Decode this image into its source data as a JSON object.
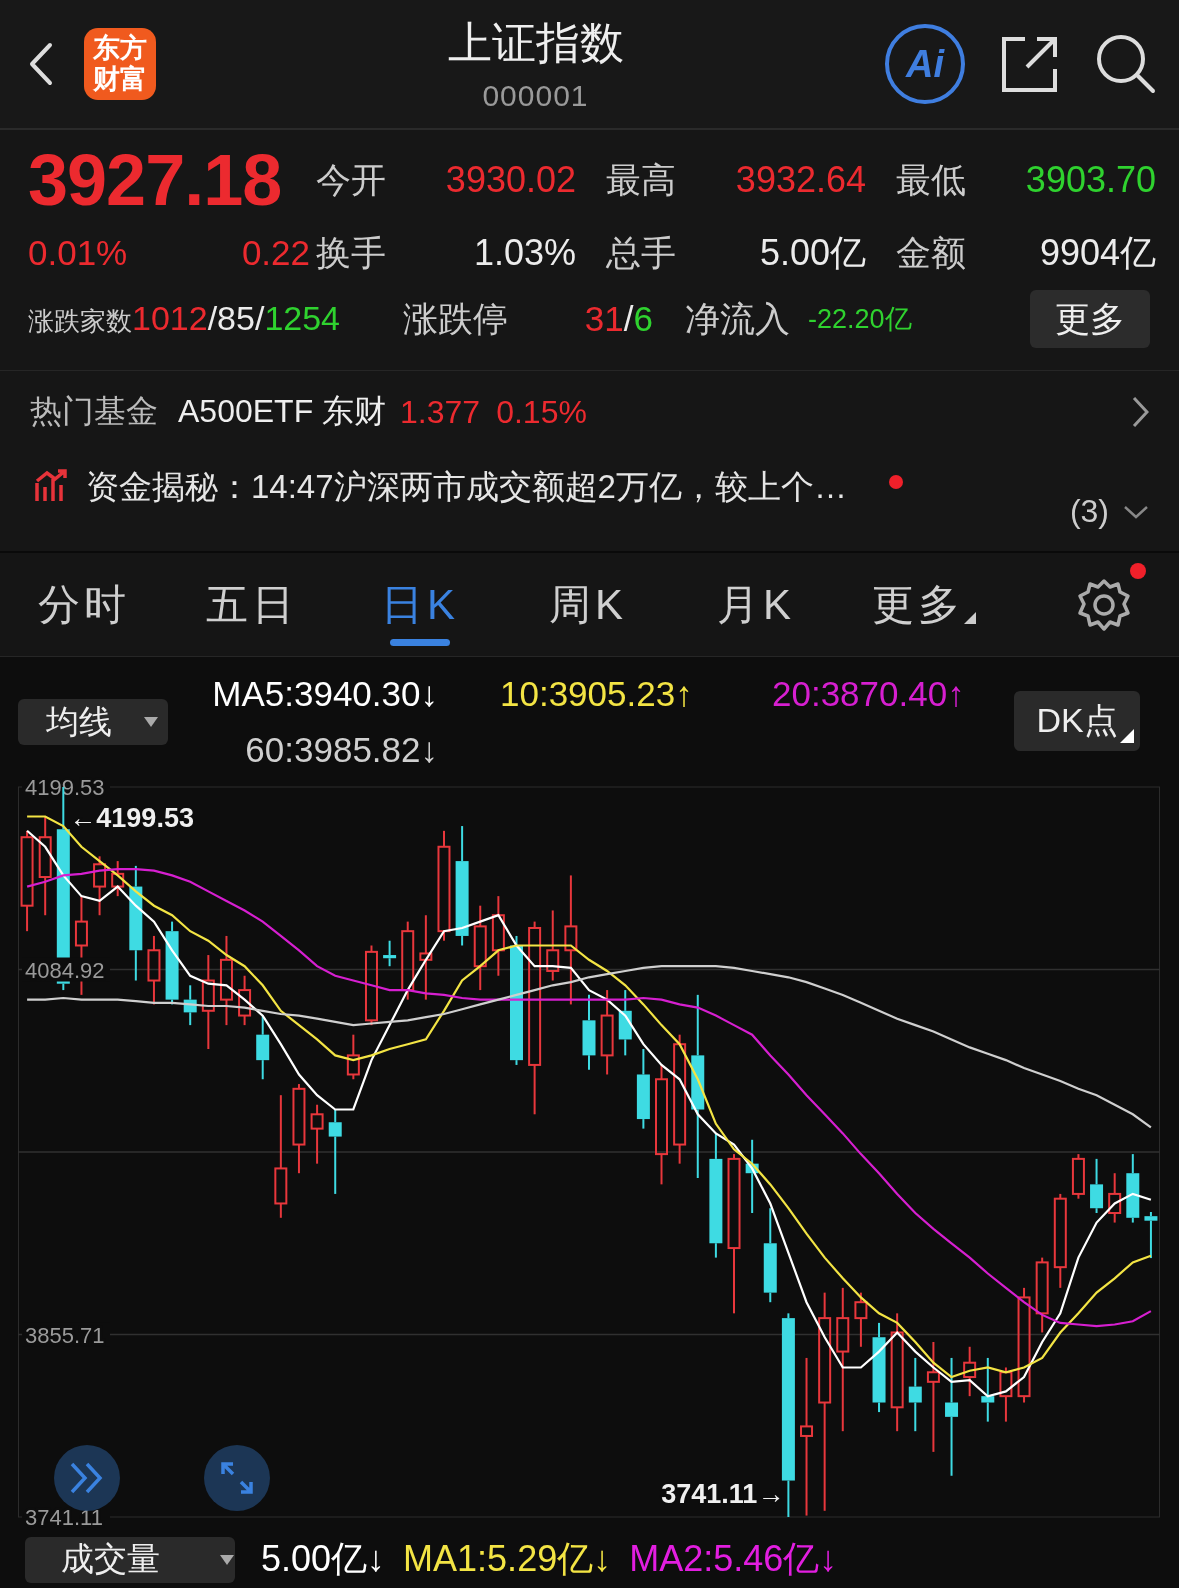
{
  "header": {
    "logo": "东方财富",
    "title": "上证指数",
    "code": "000001",
    "ai_label": "Ai"
  },
  "quote": {
    "price": "3927.18",
    "change_pct": "0.01%",
    "change": "0.22",
    "color": "#ec2a2f",
    "stats": [
      {
        "label": "今开",
        "value": "3930.02",
        "color": "#ec2a2f"
      },
      {
        "label": "最高",
        "value": "3932.64",
        "color": "#ec2a2f"
      },
      {
        "label": "最低",
        "value": "3903.70",
        "color": "#2fd22f"
      },
      {
        "label": "换手",
        "value": "1.03%",
        "color": "#ececec"
      },
      {
        "label": "总手",
        "value": "5.00亿",
        "color": "#ececec"
      },
      {
        "label": "金额",
        "value": "9904亿",
        "color": "#ececec"
      }
    ],
    "breadth": {
      "label": "涨跌家数",
      "parts": [
        {
          "text": "1012",
          "color": "#ec2a2f"
        },
        {
          "text": "/",
          "color": "#ececec"
        },
        {
          "text": "85",
          "color": "#ececec"
        },
        {
          "text": "/",
          "color": "#ececec"
        },
        {
          "text": "1254",
          "color": "#2fd22f"
        }
      ]
    },
    "limits": {
      "label": "涨跌停",
      "parts": [
        {
          "text": "31",
          "color": "#ec2a2f"
        },
        {
          "text": "/",
          "color": "#ececec"
        },
        {
          "text": "6",
          "color": "#2fd22f"
        }
      ]
    },
    "net_inflow": {
      "label": "净流入",
      "value": "-22.20亿",
      "color": "#2fd22f"
    },
    "more_button": "更多"
  },
  "hot_fund": {
    "label": "热门基金",
    "name": "A500ETF 东财",
    "price": "1.377",
    "change": "0.15%",
    "color": "#ec2a2f"
  },
  "news": {
    "text": "资金揭秘：14:47沪深两市成交额超2万亿，较上个…",
    "unread": true,
    "count": "(3)"
  },
  "tabs": [
    {
      "label": "分时",
      "selected": false,
      "dropdown": false
    },
    {
      "label": "五日",
      "selected": false,
      "dropdown": false
    },
    {
      "label": "日K",
      "selected": true,
      "dropdown": false
    },
    {
      "label": "周K",
      "selected": false,
      "dropdown": false
    },
    {
      "label": "月K",
      "selected": false,
      "dropdown": false
    },
    {
      "label": "更多",
      "selected": false,
      "dropdown": true
    }
  ],
  "settings": {
    "badge": true
  },
  "indicators": {
    "selector": "均线",
    "values": [
      {
        "text": "MA5:3940.30↓",
        "color": "#ffffff"
      },
      {
        "text": "10:3905.23↑",
        "color": "#f3e444"
      },
      {
        "text": "20:3870.40↑",
        "color": "#d61fd0"
      },
      {
        "text": "60:3985.82↓",
        "color": "#cfcfcf"
      }
    ],
    "dk_button": "DK点"
  },
  "chart": {
    "chart_data": {
      "type": "candlestick",
      "ylim": [
        3741.11,
        4199.53
      ],
      "yticks": [
        4199.53,
        4084.92,
        3855.71,
        3741.11
      ],
      "ohlc": [
        [
          4125,
          4172,
          4109,
          4168
        ],
        [
          4143,
          4181,
          4119,
          4168
        ],
        [
          4173,
          4199.53,
          4072,
          4076
        ],
        [
          4100,
          4131,
          4069,
          4115
        ],
        [
          4137,
          4156,
          4119,
          4151
        ],
        [
          4137,
          4153,
          4131,
          4145
        ],
        [
          4137,
          4150,
          4078,
          4097
        ],
        [
          4078,
          4106,
          4063,
          4097
        ],
        [
          4109,
          4115,
          4063,
          4066
        ],
        [
          4066,
          4075,
          4050,
          4058
        ],
        [
          4059,
          4094,
          4035,
          4078
        ],
        [
          4066,
          4106,
          4050,
          4091
        ],
        [
          4056,
          4081,
          4050,
          4072
        ],
        [
          4044,
          4056,
          4016,
          4028
        ],
        [
          3938,
          4006,
          3929,
          3960
        ],
        [
          3975,
          4013,
          3957,
          4010
        ],
        [
          3985,
          4000,
          3963,
          3994
        ],
        [
          3989,
          3997,
          3944,
          3980
        ],
        [
          4019,
          4044,
          4016,
          4031
        ],
        [
          4053,
          4100,
          4050,
          4096
        ],
        [
          4094,
          4103,
          4087,
          4092
        ],
        [
          4072,
          4115,
          4066,
          4109
        ],
        [
          4091,
          4119,
          4066,
          4095
        ],
        [
          4109,
          4172,
          4103,
          4162
        ],
        [
          4153,
          4175,
          4100,
          4106
        ],
        [
          4087,
          4125,
          4072,
          4112
        ],
        [
          4097,
          4131,
          4081,
          4119
        ],
        [
          4100,
          4106,
          4025,
          4028
        ],
        [
          4025,
          4115,
          3994,
          4111
        ],
        [
          4084,
          4122,
          4078,
          4097
        ],
        [
          4097,
          4144,
          4063,
          4112
        ],
        [
          4053,
          4069,
          4022,
          4031
        ],
        [
          4031,
          4072,
          4019,
          4056
        ],
        [
          4059,
          4072,
          4031,
          4041
        ],
        [
          4019,
          4035,
          3985,
          3991
        ],
        [
          3969,
          4025,
          3950,
          4016
        ],
        [
          3975,
          4044,
          3963,
          4038
        ],
        [
          4031,
          4069,
          3954,
          3997
        ],
        [
          3966,
          3982,
          3904,
          3913
        ],
        [
          3910,
          3969,
          3869,
          3966
        ],
        [
          3963,
          3978,
          3932,
          3957
        ],
        [
          3913,
          3935,
          3876,
          3882
        ],
        [
          3866,
          3869,
          3741.11,
          3764
        ],
        [
          3792,
          3841,
          3742,
          3798
        ],
        [
          3813,
          3882,
          3745,
          3866
        ],
        [
          3845,
          3885,
          3795,
          3866
        ],
        [
          3866,
          3882,
          3848,
          3876
        ],
        [
          3854,
          3863,
          3807,
          3813
        ],
        [
          3810,
          3869,
          3795,
          3857
        ],
        [
          3823,
          3841,
          3795,
          3813
        ],
        [
          3826,
          3851,
          3782,
          3832
        ],
        [
          3813,
          3841,
          3767,
          3804
        ],
        [
          3829,
          3848,
          3817,
          3838
        ],
        [
          3817,
          3841,
          3801,
          3813
        ],
        [
          3817,
          3835,
          3801,
          3832
        ],
        [
          3817,
          3885,
          3813,
          3879
        ],
        [
          3869,
          3904,
          3857,
          3901
        ],
        [
          3898,
          3944,
          3885,
          3941
        ],
        [
          3944,
          3969,
          3941,
          3966
        ],
        [
          3950,
          3966,
          3932,
          3935
        ],
        [
          3932,
          3957,
          3926,
          3944
        ],
        [
          3957,
          3969,
          3926,
          3929
        ],
        [
          3930.02,
          3932.64,
          3903.7,
          3927.18
        ]
      ],
      "annotations": [
        "←4199.53",
        "3741.11→"
      ]
    },
    "moving_averages": {
      "chart_data": {
        "type": "line",
        "ylim": [
          3741.11,
          4199.53
        ],
        "series": [
          {
            "color": "#ffffff",
            "values": [
              4172,
              4162,
              4144,
              4131,
              4128,
              4137,
              4125,
              4115,
              4097,
              4081,
              4076,
              4075,
              4066,
              4056,
              4038,
              4019,
              4006,
              3997,
              3997,
              4028,
              4050,
              4072,
              4091,
              4109,
              4111,
              4115,
              4119,
              4100,
              4087,
              4087,
              4086,
              4072,
              4066,
              4056,
              4038,
              4025,
              4016,
              3994,
              3982,
              3975,
              3960,
              3938,
              3907,
              3876,
              3854,
              3835,
              3835,
              3845,
              3857,
              3845,
              3835,
              3826,
              3827,
              3817,
              3820,
              3829,
              3851,
              3869,
              3904,
              3926,
              3938,
              3944,
              3940.3
            ]
          },
          {
            "color": "#f3e444",
            "values": [
              4181,
              4181,
              4175,
              4162,
              4153,
              4144,
              4134,
              4125,
              4119,
              4109,
              4103,
              4094,
              4087,
              4075,
              4059,
              4050,
              4041,
              4031,
              4028,
              4031,
              4035,
              4038,
              4041,
              4059,
              4078,
              4087,
              4097,
              4100,
              4100,
              4100,
              4100,
              4091,
              4084,
              4075,
              4063,
              4050,
              4038,
              4016,
              3988,
              3972,
              3963,
              3950,
              3935,
              3919,
              3904,
              3891,
              3879,
              3869,
              3863,
              3851,
              3838,
              3829,
              3833,
              3835,
              3832,
              3835,
              3841,
              3857,
              3869,
              3882,
              3891,
              3901,
              3905.23
            ]
          },
          {
            "color": "#d61fd0",
            "values": [
              4137,
              4140,
              4144,
              4145,
              4147,
              4148,
              4148,
              4147,
              4144,
              4140,
              4134,
              4128,
              4122,
              4115,
              4106,
              4097,
              4087,
              4081,
              4078,
              4075,
              4072,
              4072,
              4070,
              4069,
              4067,
              4066,
              4066,
              4066,
              4066,
              4066,
              4066,
              4066,
              4066,
              4066,
              4067,
              4066,
              4063,
              4061,
              4056,
              4050,
              4044,
              4031,
              4019,
              4006,
              3994,
              3982,
              3969,
              3957,
              3944,
              3932,
              3922,
              3913,
              3904,
              3894,
              3885,
              3876,
              3868,
              3863,
              3862,
              3861,
              3862,
              3864,
              3870.4
            ]
          },
          {
            "color": "#cfcfcf",
            "values": [
              4066,
              4066,
              4067,
              4066,
              4066,
              4066,
              4065,
              4064,
              4064,
              4063,
              4062,
              4062,
              4061,
              4059,
              4057,
              4056,
              4054,
              4052,
              4050,
              4051,
              4052,
              4053,
              4055,
              4057,
              4060,
              4063,
              4066,
              4069,
              4072,
              4075,
              4077,
              4080,
              4082,
              4084,
              4086,
              4087,
              4087,
              4087,
              4087,
              4086,
              4084,
              4082,
              4080,
              4077,
              4073,
              4069,
              4064,
              4059,
              4054,
              4050,
              4046,
              4041,
              4036,
              4032,
              4028,
              4023,
              4019,
              4015,
              4010,
              4006,
              4000,
              3994,
              3985.82
            ]
          }
        ]
      }
    }
  },
  "volume": {
    "selector": "成交量",
    "values": [
      {
        "text": "5.00亿↓",
        "color": "#ffffff"
      },
      {
        "text": "MA1:5.29亿↓",
        "color": "#f3e444"
      },
      {
        "text": "MA2:5.46亿↓",
        "color": "#e21ee0"
      }
    ]
  }
}
